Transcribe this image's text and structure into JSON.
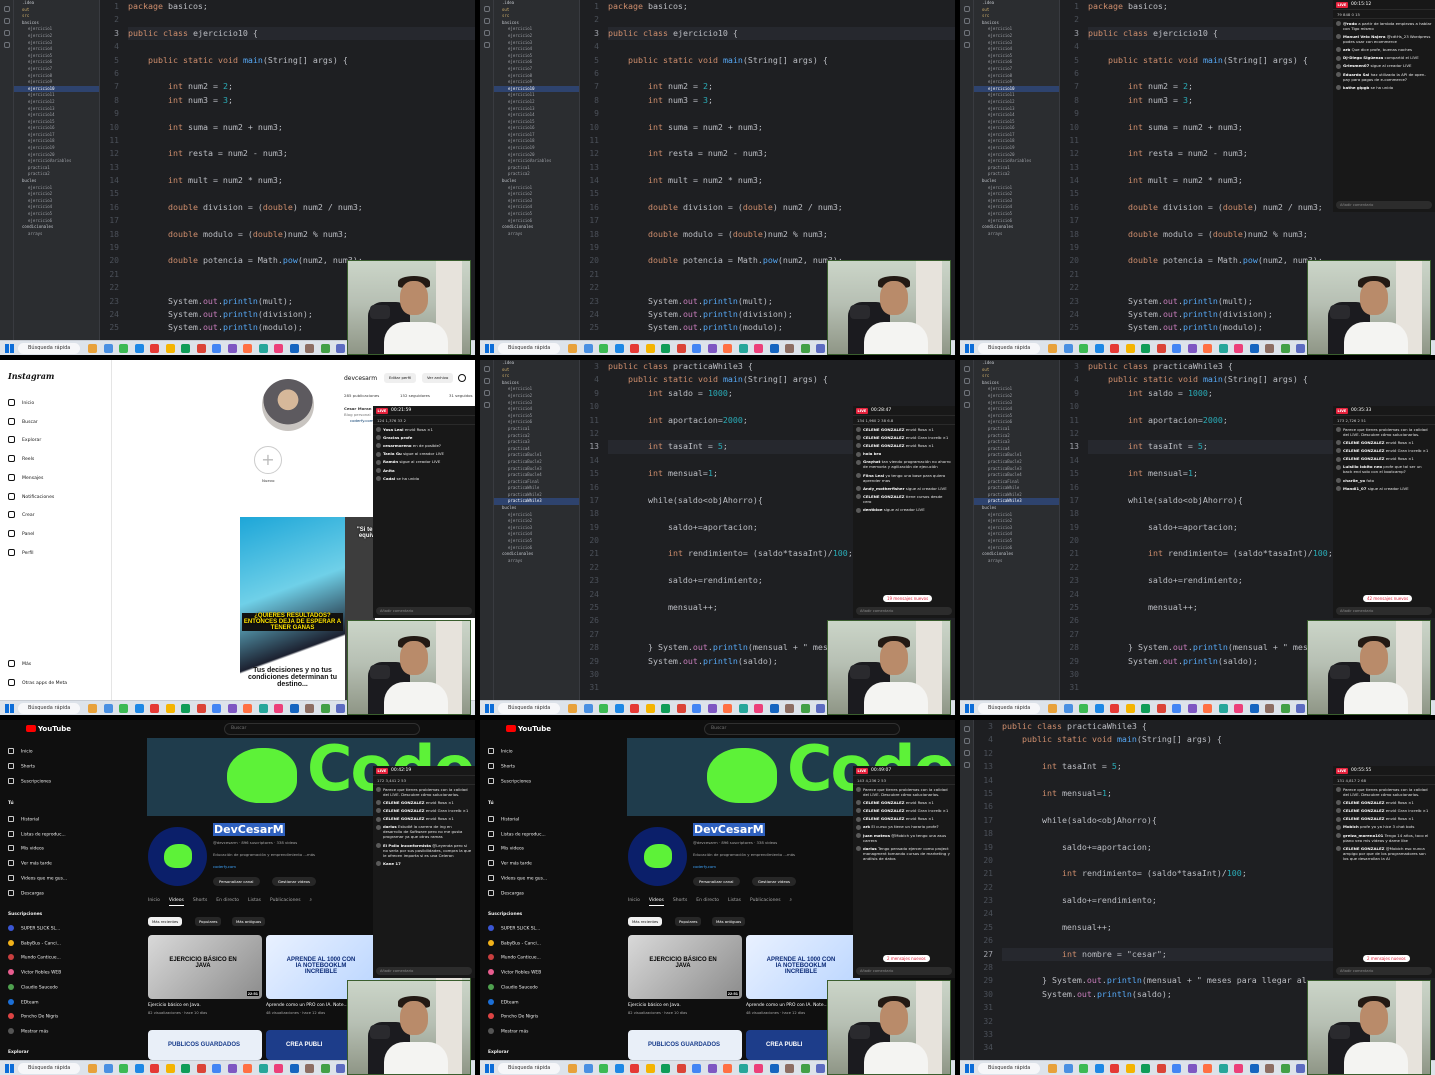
{
  "taskbar": {
    "search_placeholder": "Búsqueda rápida"
  },
  "ide_a": {
    "gutter": [
      "1",
      "2",
      "3",
      "4",
      "5",
      "6",
      "7",
      "8",
      "9",
      "10",
      "11",
      "12",
      "13",
      "14",
      "15",
      "16",
      "17",
      "18",
      "19",
      "20",
      "21",
      "22",
      "23",
      "24",
      "25"
    ],
    "lines": [
      "package basicos;",
      "",
      "public class ejercicio10 {",
      "",
      "    public static void main(String[] args) {",
      "",
      "        int num2 = 2;",
      "        int num3 = 3;",
      "",
      "        int suma = num2 + num3;",
      "",
      "        int resta = num2 - num3;",
      "",
      "        int mult = num2 * num3;",
      "",
      "        double division = (double) num2 / num3;",
      "",
      "        double modulo = (double)num2 % num3;",
      "",
      "        double potencia = Math.pow(num2, num3);",
      "",
      "",
      "        System.out.println(mult);",
      "        System.out.println(division);",
      "        System.out.println(modulo);"
    ]
  },
  "ide_b": {
    "gutter": [
      "3",
      "4",
      "9",
      "10",
      "11",
      "12",
      "13",
      "14",
      "15",
      "16",
      "17",
      "18",
      "19",
      "20",
      "21",
      "22",
      "23",
      "24",
      "25",
      "26",
      "27",
      "28",
      "29",
      "30",
      "31"
    ],
    "lines": [
      "public class practicaWhile3 {",
      "    public static void main(String[] args) {",
      "        int saldo = 1000;",
      "",
      "        int aportacion=2000;",
      "",
      "        int tasaInt = 5;",
      "",
      "        int mensual=1;",
      "",
      "        while(saldo<objAhorro){",
      "",
      "            saldo+=aportacion;",
      "",
      "            int rendimiento= (saldo*tasaInt)/100;",
      "",
      "            saldo+=rendimiento;",
      "",
      "            mensual++;",
      "",
      "",
      "        } System.out.println(mensual + \" meses para llegar al",
      "        System.out.println(saldo);",
      "",
      ""
    ]
  },
  "ide_c": {
    "gutter": [
      "3",
      "4",
      "12",
      "13",
      "14",
      "15",
      "16",
      "17",
      "18",
      "19",
      "20",
      "21",
      "22",
      "23",
      "24",
      "25",
      "26",
      "27",
      "28",
      "29",
      "30",
      "31",
      "32",
      "33",
      "34"
    ],
    "lines": [
      "public class practicaWhile3 {",
      "    public static void main(String[] args) {",
      "",
      "        int tasaInt = 5;",
      "",
      "        int mensual=1;",
      "",
      "        while(saldo<objAhorro){",
      "",
      "            saldo+=aportacion;",
      "",
      "            int rendimiento= (saldo*tasaInt)/100;",
      "",
      "            saldo+=rendimiento;",
      "",
      "            mensual++;",
      "",
      "            int nombre = \"cesar\";",
      "",
      "        } System.out.println(mensual + \" meses para llegar al",
      "        System.out.println(saldo);",
      "",
      "",
      "",
      ""
    ]
  },
  "tree_a": [
    "ejercicio1",
    "ejercicio2",
    "ejercicio3",
    "ejercicio4",
    "ejercicio5",
    "ejercicio6",
    "ejercicio7",
    "ejercicio8",
    "ejercicio9",
    "ejercicio10",
    "ejercicio11",
    "ejercicio12",
    "ejercicio13",
    "ejercicio14",
    "ejercicio15",
    "ejercicio16",
    "ejercicio17",
    "ejercicio18",
    "ejercicio19",
    "ejercicio20",
    "ejercicioVariables",
    "practica1",
    "practica2"
  ],
  "tree_b": [
    "ejercicio1",
    "ejercicio2",
    "ejercicio3",
    "ejercicio4",
    "ejercicio5",
    "ejercicio6",
    "practica1",
    "practica2",
    "practica3",
    "practica4",
    "practicaBucle1",
    "practicaBucle2",
    "practicaBucle3",
    "practicaBucle4",
    "practicaFinal",
    "practicaWhile",
    "practicaWhile2",
    "practicaWhile3"
  ],
  "tree_labels": {
    "idea": ".idea",
    "out": "out",
    "src": "src",
    "basicos": "basicos",
    "bucles": "bucles",
    "condicionales": "condicionales",
    "arrays": "arrays"
  },
  "chats": {
    "c1": {
      "live": "LIVE",
      "time": "00:15:12",
      "stats": "79   848   0   15",
      "msgs": [
        {
          "u": "@rodo",
          "t": "a partir de lambda empiezas a hablar con Tigo mismo"
        },
        {
          "u": "Manuel Velo Najera",
          "t": "@cdtHs_23 Wordpress podes usar con ecommerce"
        },
        {
          "u": "arb",
          "t": "Que dice profe, buenas noches"
        },
        {
          "u": "DJ-Diego Sigüenza",
          "t": "compartió el LIVE"
        },
        {
          "u": "Griesmen07",
          "t": "sigue al creador LIVE"
        },
        {
          "u": "Eduardo Sal",
          "t": "haz utilizado la API de open-pay para pagos de e-commerce?"
        },
        {
          "u": "kathe gipgb",
          "t": "se ha unido"
        }
      ],
      "input": "Añadir comentario"
    },
    "c2": {
      "live": "LIVE",
      "time": "00:21:59",
      "stats": "124   1,376   33   2",
      "msgs": [
        {
          "u": "Yosa Leal",
          "t": "envió Rosa ×1"
        },
        {
          "u": "Gracias profe",
          "t": ""
        },
        {
          "u": "cesarmoreno",
          "t": "en de posible?"
        },
        {
          "u": "Tania Gu",
          "t": "sigue al creador LIVE"
        },
        {
          "u": "Ramón",
          "t": "sigue al creador LIVE"
        },
        {
          "u": "Anita",
          "t": ""
        },
        {
          "u": "Cadal",
          "t": "se ha unido"
        }
      ],
      "input": "Añadir comentario"
    },
    "c3": {
      "live": "LIVE",
      "time": "00:28:47",
      "stats": "134   1,960   2   38   6.8",
      "msgs": [
        {
          "u": "CELENE GONZALEZ",
          "t": "envió Rosa ×1"
        },
        {
          "u": "CELENE GONZALEZ",
          "t": "envió Gran increíb ×1"
        },
        {
          "u": "CELENE GONZALEZ",
          "t": "envió Rosa ×1"
        },
        {
          "u": "hola bro",
          "t": ""
        },
        {
          "u": "Grayhat",
          "t": "tan viendo programación no ahorro de memoria y agilización de ejecución"
        },
        {
          "u": "Flina Leal",
          "t": "yo tengo una base para quiero aprender mas"
        },
        {
          "u": "Andy_motherfisher",
          "t": "sigue al creador LIVE"
        },
        {
          "u": "CELENE GONZALEZ",
          "t": "tiene cursos desde cero"
        },
        {
          "u": "dentbloe",
          "t": "sigue al creador LIVE"
        }
      ],
      "pill": "19 mensajes nuevos",
      "input": "Añadir comentario"
    },
    "c4": {
      "live": "LIVE",
      "time": "00:35:33",
      "stats": "173   2,726   2   51",
      "msgs": [
        {
          "u": "",
          "t": "Parece que tienes problemas con la calidad del LIVE. Descubre cómo solucionarlos."
        },
        {
          "u": "CELENE GONZALEZ",
          "t": "envió Rosa ×1"
        },
        {
          "u": "CELENE GONZALEZ",
          "t": "envió Gran increíb ×1"
        },
        {
          "u": "CELENE GONZALEZ",
          "t": "envió Rosa ×1"
        },
        {
          "u": "Luisillo lobito neo",
          "t": "profe que tal ser un back end solo con el bootcamp?"
        },
        {
          "u": "charlie_yo",
          "t": "foto"
        },
        {
          "u": "Mandi1_07",
          "t": "sigue al creador LIVE"
        }
      ],
      "pill": "42 mensajes nuevos",
      "input": "Añadir comentario"
    },
    "c5": {
      "live": "LIVE",
      "time": "00:42:19",
      "stats": "172   3,441   2   53",
      "msgs": [
        {
          "u": "",
          "t": "Parece que tienes problemas con la calidad del LIVE. Descubre cómo solucionarlos."
        },
        {
          "u": "CELENE GONZALEZ",
          "t": "envió Rosa ×1"
        },
        {
          "u": "CELENE GONZALEZ",
          "t": "envió Gran increíb ×1"
        },
        {
          "u": "CELENE GONZALEZ",
          "t": "envió Rosa ×1"
        },
        {
          "u": "darius",
          "t": "Estudié la carrera de ing en desarrollo de Software pero no me gusta programar ya que otras ramas"
        },
        {
          "u": "El Pollo Inconformista",
          "t": "@Leyenda pero si no sería por sus posibilidades, compra la que le ofrecen importa si es una Celeron"
        },
        {
          "u": "Kane 17",
          "t": ""
        }
      ],
      "input": "Añadir comentario"
    },
    "c6": {
      "live": "LIVE",
      "time": "00:49:07",
      "stats": "143   4,236   2   53",
      "msgs": [
        {
          "u": "",
          "t": "Parece que tienes problemas con la calidad del LIVE. Descubre cómo solucionarlos."
        },
        {
          "u": "CELENE GONZALEZ",
          "t": "envió Rosa ×1"
        },
        {
          "u": "CELENE GONZALEZ",
          "t": "envió Gran increíb ×1"
        },
        {
          "u": "CELENE GONZALEZ",
          "t": "envió Rosa ×1"
        },
        {
          "u": "ark",
          "t": "El curso ya tiene un horario profe?"
        },
        {
          "u": "juan mateos",
          "t": "@Mobich yo tengo una asus carrera"
        },
        {
          "u": "darius",
          "t": "Tengo pensado ejercer como project managment tomando cursos de marketing y análisis de datos"
        }
      ],
      "pill": "2 mensajes nuevos",
      "input": "Añadir comentario"
    },
    "c7": {
      "live": "LIVE",
      "time": "00:55:55",
      "stats": "131   4,817   2   68",
      "msgs": [
        {
          "u": "",
          "t": "Parece que tienes problemas con la calidad del LIVE. Descubre cómo solucionarlos."
        },
        {
          "u": "CELENE GONZALEZ",
          "t": "envió Rosa ×1"
        },
        {
          "u": "CELENE GONZALEZ",
          "t": "envió Gran increíb ×1"
        },
        {
          "u": "CELENE GONZALEZ",
          "t": "envió Rosa ×1"
        },
        {
          "u": "Mobich",
          "t": "profe yo ya hice 3 chat bots"
        },
        {
          "u": "greiza_moreno101",
          "t": "Tengo 14 años, toco el piano veo mis videos y dame like"
        },
        {
          "u": "CELENE GONZALEZ",
          "t": "@Mobich eso nunca ampigo por que de los programadores son los que desarrollan la AI"
        }
      ],
      "pill": "2 mensajes nuevos",
      "input": "Añadir comentario"
    }
  },
  "instagram": {
    "logo": "Instagram",
    "nav": [
      "Inicio",
      "Buscar",
      "Explorar",
      "Reels",
      "Mensajes",
      "Notificaciones",
      "Crear",
      "Panel",
      "Perfil"
    ],
    "bottom": [
      "Más",
      "Otras apps de Meta"
    ],
    "username": "devcesarm",
    "edit": "Editar perfil",
    "archive": "Ver archivo",
    "posts": "285 publicaciones",
    "followers": "152 seguidores",
    "following": "31 seguidos",
    "name": "Cesar Moran",
    "bio": "Blog personal",
    "link": "coderfy.com",
    "new": "Nuevo",
    "post1_top": "\"Si te vas a equivocar",
    "post1_mid": "¿QUIERES RESULTADOS? ENTONCES DEJA DE ESPERAR A TENER GANAS",
    "post1_bottom": "Tus decisiones y no tus condiciones determinan tu destino..."
  },
  "youtube": {
    "logo": "YouTube",
    "search": "Buscar",
    "sidebar_top": [
      "Inicio",
      "Shorts",
      "Suscripciones"
    ],
    "you": "Tú",
    "sidebar_you": [
      "Historial",
      "Listas de reproduc...",
      "Mis videos",
      "Ver más tarde",
      "Videos que me gus...",
      "Descargas"
    ],
    "subs_header": "Suscripciones",
    "subs": [
      "SUPER SLICK SL...",
      "BabyBus - Canci...",
      "Mundo Canticue...",
      "Victor Robles WEB",
      "Claudio Saucedo",
      "EDteam",
      "Poncho De Nigris",
      "Mostrar más"
    ],
    "explore": "Explorar",
    "banner": "Coder",
    "channel": "DevCesarM",
    "handle": "@devcesarm · 896 suscriptores · 338 videos",
    "desc": "Educación de programación y emprendimiento ...más",
    "site": "coderfy.com",
    "customize": "Personalizar canal",
    "manage": "Gestionar videos",
    "tabs": [
      "Inicio",
      "Videos",
      "Shorts",
      "En directo",
      "Listas",
      "Publicaciones"
    ],
    "chips": [
      "Más recientes",
      "Populares",
      "Más antiguos"
    ],
    "videos": [
      {
        "thumb": "EJERCICIO BÁSICO EN JAVA",
        "dur": "22:51",
        "title": "Ejercicio básico en Java.",
        "meta": "82 visualizaciones · hace 10 días"
      },
      {
        "thumb": "APRENDE AL 1000 CON IA NOTEBOOKLM INCREIBLE",
        "dur": "",
        "title": "Aprende como un PRO con IA. Note...",
        "meta": "48 visualizaciones · hace 12 días"
      }
    ],
    "row2": [
      "PUBLICOS GUARDADOS",
      "CREA PUBLI"
    ]
  }
}
